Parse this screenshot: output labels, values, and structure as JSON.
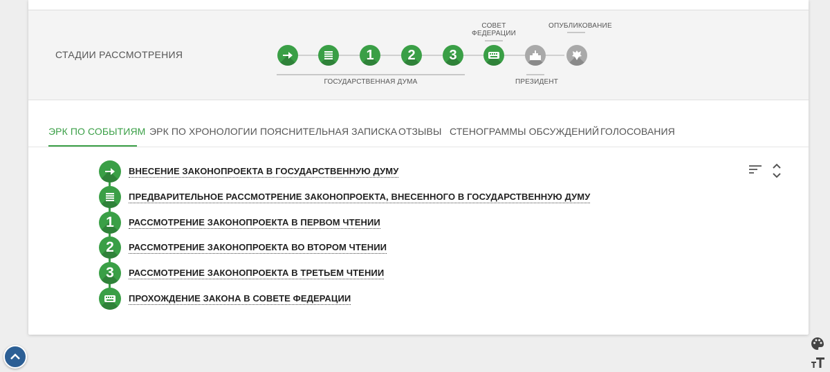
{
  "colors": {
    "accent": "#3a9f46",
    "inactive": "#a9a9a9",
    "background": "#eeeeee",
    "scroll_button": "#2c5f95"
  },
  "stages": {
    "title": "СТАДИИ РАССМОТРЕНИЯ",
    "captions": {
      "duma": "ГОСУДАРСТВЕННАЯ ДУМА",
      "council_line1": "СОВЕТ",
      "council_line2": "ФЕДЕРАЦИИ",
      "president": "ПРЕЗИДЕНТ",
      "published": "ОПУБЛИКОВАНИЕ"
    },
    "items": [
      {
        "icon": "arrow-right-icon",
        "label": "",
        "status": "done"
      },
      {
        "icon": "document-list-icon",
        "label": "",
        "status": "done"
      },
      {
        "icon": "number",
        "label": "1",
        "status": "done"
      },
      {
        "icon": "number",
        "label": "2",
        "status": "done"
      },
      {
        "icon": "number",
        "label": "3",
        "status": "done"
      },
      {
        "icon": "keyboard-icon",
        "label": "",
        "status": "done"
      },
      {
        "icon": "kremlin-icon",
        "label": "",
        "status": "pending"
      },
      {
        "icon": "emblem-icon",
        "label": "",
        "status": "pending"
      }
    ]
  },
  "tabs": [
    {
      "label": "ЭРК ПО СОБЫТИЯМ",
      "active": true
    },
    {
      "label": "ЭРК ПО ХРОНОЛОГИИ",
      "active": false
    },
    {
      "label": "ПОЯСНИТЕЛЬНАЯ ЗАПИСКА",
      "active": false
    },
    {
      "label": "ОТЗЫВЫ",
      "active": false
    },
    {
      "label": "СТЕНОГРАММЫ ОБСУЖДЕНИЙ",
      "active": false
    },
    {
      "label": "ГОЛОСОВАНИЯ",
      "active": false
    }
  ],
  "events": [
    {
      "icon": "arrow-right-icon",
      "number": "",
      "label": "ВНЕСЕНИЕ ЗАКОНОПРОЕКТА В ГОСУДАРСТВЕННУЮ ДУМУ"
    },
    {
      "icon": "document-list-icon",
      "number": "",
      "label": "ПРЕДВАРИТЕЛЬНОЕ РАССМОТРЕНИЕ ЗАКОНОПРОЕКТА, ВНЕСЕННОГО В ГОСУДАРСТВЕННУЮ ДУМУ"
    },
    {
      "icon": "number",
      "number": "1",
      "label": "РАССМОТРЕНИЕ ЗАКОНОПРОЕКТА В ПЕРВОМ ЧТЕНИИ"
    },
    {
      "icon": "number",
      "number": "2",
      "label": "РАССМОТРЕНИЕ ЗАКОНОПРОЕКТА ВО ВТОРОМ ЧТЕНИИ"
    },
    {
      "icon": "number",
      "number": "3",
      "label": "РАССМОТРЕНИЕ ЗАКОНОПРОЕКТА В ТРЕТЬЕМ ЧТЕНИИ"
    },
    {
      "icon": "keyboard-icon",
      "number": "",
      "label": "ПРОХОЖДЕНИЕ ЗАКОНА В СОВЕТЕ ФЕДЕРАЦИИ"
    }
  ],
  "toolbar": {
    "sort_icon": "sort-icon",
    "expand_icon": "expand-collapse-icon"
  },
  "floating": {
    "scroll_icon": "chevron-up-icon",
    "palette_icon": "palette-icon",
    "font_icon": "font-size-icon"
  }
}
